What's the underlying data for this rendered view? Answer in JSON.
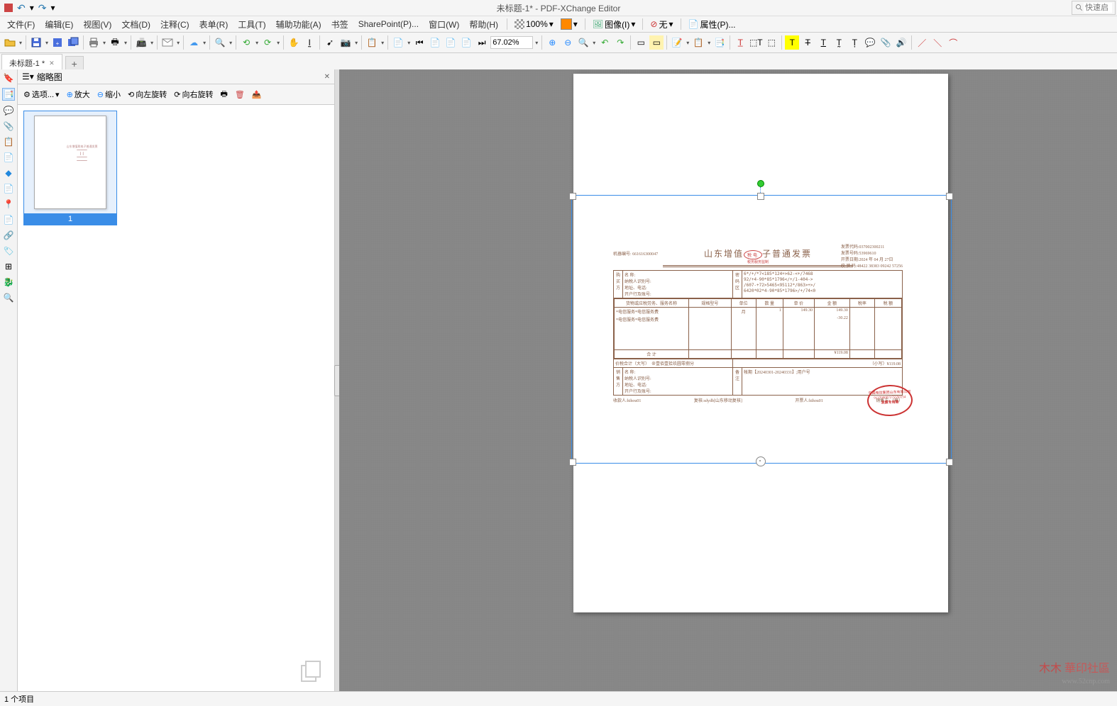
{
  "title": "未标题-1* - PDF-XChange Editor",
  "search_placeholder": "快速启",
  "menu": [
    "文件(F)",
    "编辑(E)",
    "视图(V)",
    "文档(D)",
    "注释(C)",
    "表单(R)",
    "工具(T)",
    "辅助功能(A)",
    "书签",
    "SharePoint(P)...",
    "窗口(W)",
    "帮助(H)"
  ],
  "menu_extra": {
    "zoom100": "100%",
    "image": "图像(I)",
    "none": "无",
    "properties": "属性(P)..."
  },
  "zoom_level": "67.02%",
  "tab": {
    "name": "未标题-1 *"
  },
  "thumbnails": {
    "title": "缩略图",
    "options": "选项...",
    "zoomin": "放大",
    "zoomout": "缩小",
    "rot_left": "向左旋转",
    "rot_right": "向右旋转",
    "page_num": "1"
  },
  "invoice": {
    "machine_label": "机器编号:",
    "machine": "661616300047",
    "main_title": "山东增值税电子普通发票",
    "stamp_top": "税务服务监制",
    "info_labels": {
      "code": "发票代码:",
      "num": "发票号码:",
      "date": "开票日期:",
      "check": "校 验 码:"
    },
    "info_values": {
      "code": "037002300211",
      "num": "53969610",
      "date": "2024 年 04 月 27日",
      "check": "48422 38383 09242 57256"
    },
    "buyer_labels": [
      "名    称:",
      "纳税人识别号:",
      "地址、电话:",
      "开户行及账号:"
    ],
    "cipher_label": "密码区",
    "cipher": [
      "6*/+/*7<185*124+>62-<+/7468",
      "92/+4-90*85*1796</+/1-404->",
      "/607-+72>5465<95112*/863>+>/",
      "6420*02*4-90*85*1796>/+/74<0"
    ],
    "cols": [
      "货物或应税劳务、服务名称",
      "规格型号",
      "单位",
      "数 量",
      "单 价",
      "金 额",
      "税率",
      "税 额"
    ],
    "rows": [
      {
        "name": "*电信服务*电信服务费",
        "spec": "",
        "unit": "月",
        "qty": "1",
        "price": "149.30",
        "amount": "149.30",
        "rate": "",
        "tax": ""
      },
      {
        "name": "*电信服务*电信服务费",
        "spec": "",
        "unit": "",
        "qty": "",
        "price": "",
        "amount": "-30.22",
        "rate": "",
        "tax": ""
      }
    ],
    "total_label": "合  计",
    "total": "¥119.08",
    "sum_label": "价税合计（大写）",
    "sum_cn": "⊗壹佰壹拾玖圆零捌分",
    "sum_small_label": "（小写）",
    "sum_small": "¥119.08",
    "seller_labels": [
      "名    称:",
      "纳税人识别号:",
      "地址、电话:",
      "开户行及账号:"
    ],
    "remark_label": "备注",
    "remark": "帐期【20240301-20240331】;用户号",
    "payee_l": "收款人:",
    "payee": "hihou01",
    "reviewer_l": "复核:",
    "reviewer": "sdydb[山东移动复核]",
    "drawer_l": "开票人:",
    "drawer": "hihou01",
    "seller_stamp_l": "销售方:（章）",
    "stamp_text1": "913700007275550154",
    "stamp_text2": "发票专用章"
  },
  "status": "1 个项目",
  "watermark": {
    "brand": "華印社區",
    "url": "www.52cnp.com"
  }
}
